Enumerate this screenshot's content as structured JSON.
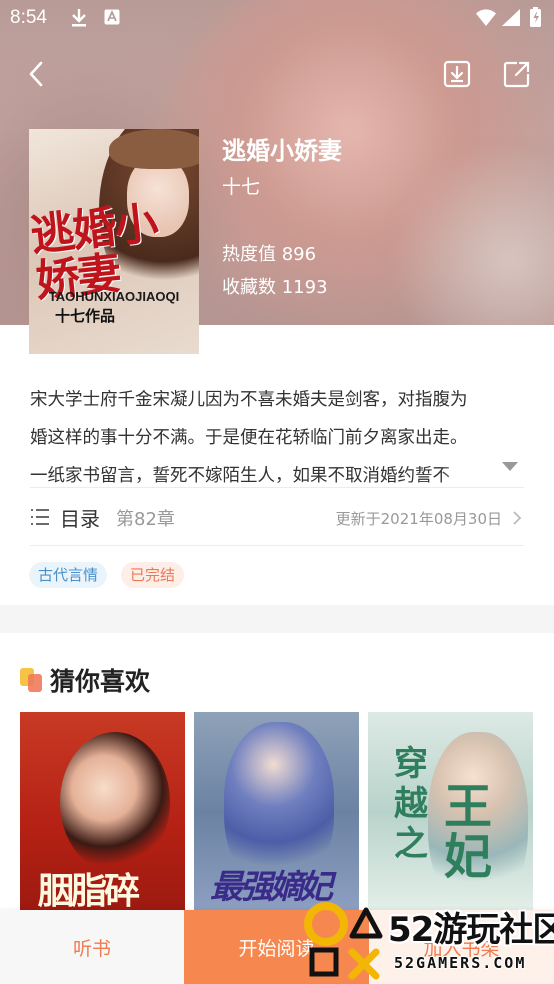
{
  "status_bar": {
    "time": "8:54"
  },
  "book": {
    "title": "逃婚小娇妻",
    "author": "十七",
    "heat": "热度值 896",
    "favorites": "收藏数 1193",
    "cover": {
      "art_title": "逃婚小娇妻",
      "pinyin": "TAOHUNXIAOJIAOQI",
      "byline": "十七作品"
    },
    "description_lines": [
      "宋大学士府千金宋凝儿因为不喜未婚夫是剑客，对指腹为",
      "婚这样的事十分不满。于是便在花轿临门前夕离家出走。",
      "一纸家书留言，誓死不嫁陌生人，如果不取消婚约誓不"
    ]
  },
  "toc": {
    "label": "目录",
    "chapter_count": "第82章",
    "updated": "更新于2021年08月30日"
  },
  "tags": [
    "古代言情",
    "已完结"
  ],
  "recommend": {
    "title": "猜你喜欢",
    "books": [
      {
        "art": "胭脂碎"
      },
      {
        "art": "最强嫡妃"
      },
      {
        "art_a": "穿越之",
        "art_b": "王妃"
      }
    ]
  },
  "bottom_bar": {
    "listen": "听书",
    "read": "开始阅读",
    "add_shelf": "加入书架"
  },
  "watermark": {
    "big": "52游玩社区",
    "small": "52GAMERS.COM"
  },
  "icons": {
    "back": "back-arrow-icon",
    "download": "download-icon",
    "share": "share-icon",
    "toc": "list-icon",
    "chevron": "chevron-right-icon",
    "expand": "triangle-down-icon"
  },
  "colors": {
    "accent": "#f6884f",
    "accent_text": "#f07b4e",
    "tag_blue": "#4a90c8",
    "tag_orange": "#e87a57"
  }
}
